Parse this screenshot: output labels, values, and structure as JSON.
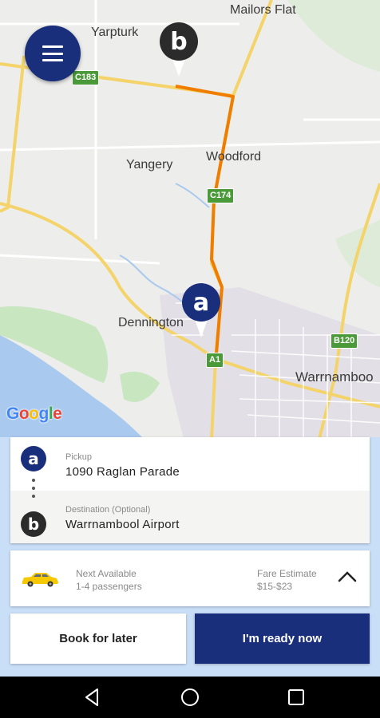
{
  "map": {
    "places": {
      "mailors_flat": "Mailors Flat",
      "yarpturk": "Yarpturk",
      "yangery": "Yangery",
      "woodford": "Woodford",
      "dennington": "Dennington",
      "warrnambool": "Warrnamboo"
    },
    "roads": {
      "c183": "C183",
      "c174": "C174",
      "a1": "A1",
      "b120": "B120"
    },
    "google_logo": [
      "G",
      "o",
      "o",
      "g",
      "l",
      "e"
    ],
    "google_colors": [
      "#4285F4",
      "#EA4335",
      "#FBBC05",
      "#4285F4",
      "#34A853",
      "#EA4335"
    ],
    "route_color": "#ef7d00",
    "pin_a_letter": "a",
    "pin_b_letter": "b"
  },
  "menu_icon": "hamburger-menu-icon",
  "route": {
    "pickup_badge": "a",
    "pickup_label": "Pickup",
    "pickup_value": "1090 Raglan Parade",
    "destination_badge": "b",
    "destination_label": "Destination (Optional)",
    "destination_value": "Warrnambool Airport"
  },
  "ride": {
    "vehicle_icon": "taxi-car-icon",
    "availability_label": "Next Available",
    "passengers": "1-4 passengers",
    "fare_label": "Fare Estimate",
    "fare_value": "$15-$23",
    "expand_icon": "chevron-up-icon"
  },
  "actions": {
    "book_later": "Book for later",
    "ready_now": "I'm ready now"
  },
  "navbar": {
    "back_icon": "back-triangle-icon",
    "home_icon": "home-circle-icon",
    "recents_icon": "recents-square-icon"
  },
  "colors": {
    "brand_navy": "#1a2f7c",
    "panel_bg": "#c9def7",
    "route_orange": "#ef7d00"
  }
}
